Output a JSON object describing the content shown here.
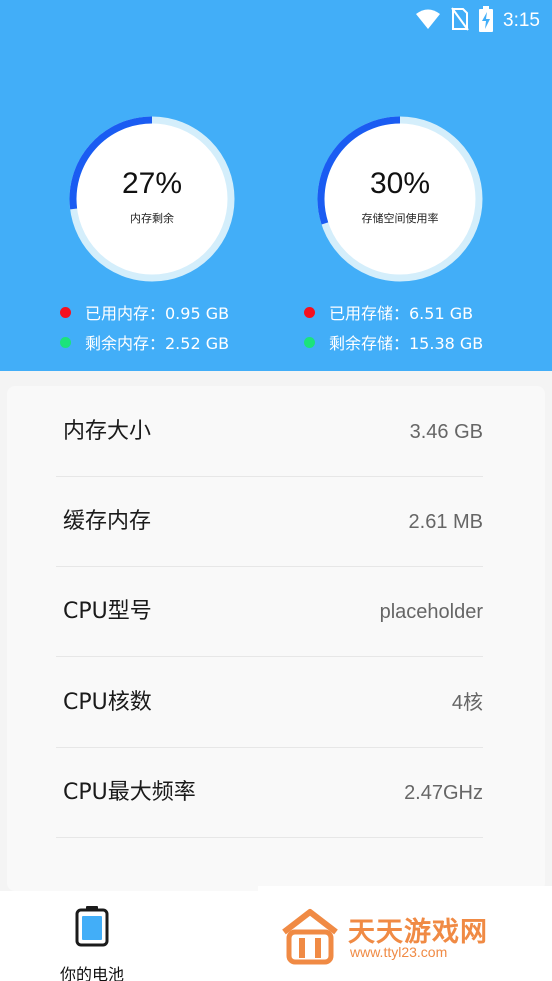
{
  "status_bar": {
    "time": "3:15"
  },
  "memory_gauge": {
    "percent": "27%",
    "label": "内存剩余",
    "fraction": 0.27
  },
  "storage_gauge": {
    "percent": "30%",
    "label": "存储空间使用率",
    "fraction": 0.3
  },
  "memory_legend": {
    "used": "已用内存：0.95 GB",
    "free": "剩余内存：2.52 GB"
  },
  "storage_legend": {
    "used": "已用存储：6.51 GB",
    "free": "剩余存储：15.38 GB"
  },
  "info_rows": [
    {
      "key": "内存大小",
      "value": "3.46 GB"
    },
    {
      "key": "缓存内存",
      "value": "2.61 MB"
    },
    {
      "key": "CPU型号",
      "value": "placeholder"
    },
    {
      "key": "CPU核数",
      "value": "4核"
    },
    {
      "key": "CPU最大频率",
      "value": "2.47GHz"
    }
  ],
  "bottom_nav": {
    "tab_label": "你的电池"
  },
  "watermark": {
    "title": "天天游戏网",
    "url": "www.ttyl23.com"
  },
  "colors": {
    "header": "#42aef8",
    "arc": "#1a5cf2",
    "ring": "#d4eefb",
    "used_dot": "#f5101f",
    "free_dot": "#1be37c",
    "watermark": "#f08a44"
  },
  "icons": [
    "wifi-icon",
    "no-sim-icon",
    "battery-charging-icon",
    "battery-icon",
    "logo-icon"
  ]
}
